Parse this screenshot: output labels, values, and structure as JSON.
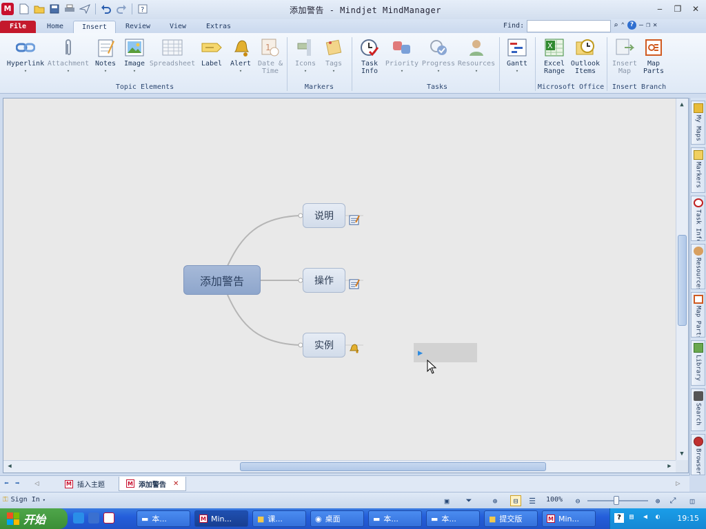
{
  "window": {
    "title": "添加警告 - Mindjet MindManager",
    "app_icon_letter": "M"
  },
  "tabs": [
    {
      "label": "File"
    },
    {
      "label": "Home"
    },
    {
      "label": "Insert"
    },
    {
      "label": "Review"
    },
    {
      "label": "View"
    },
    {
      "label": "Extras"
    }
  ],
  "find": {
    "label": "Find:",
    "value": ""
  },
  "ribbon": {
    "topic_elements": {
      "label": "Topic Elements",
      "buttons": [
        {
          "label": "Hyperlink"
        },
        {
          "label": "Attachment"
        },
        {
          "label": "Notes"
        },
        {
          "label": "Image"
        },
        {
          "label": "Spreadsheet"
        },
        {
          "label": "Label"
        },
        {
          "label": "Alert"
        },
        {
          "label1": "Date &",
          "label2": "Time"
        }
      ]
    },
    "markers": {
      "label": "Markers",
      "buttons": [
        {
          "label": "Icons"
        },
        {
          "label": "Tags"
        }
      ]
    },
    "tasks": {
      "label": "Tasks",
      "buttons": [
        {
          "label1": "Task",
          "label2": "Info"
        },
        {
          "label": "Priority"
        },
        {
          "label": "Progress"
        },
        {
          "label": "Resources"
        },
        {
          "label": "Gantt"
        }
      ]
    },
    "office": {
      "label": "Microsoft Office",
      "buttons": [
        {
          "label1": "Excel",
          "label2": "Range"
        },
        {
          "label1": "Outlook",
          "label2": "Items"
        }
      ]
    },
    "branch": {
      "label": "Insert Branch",
      "buttons": [
        {
          "label1": "Insert",
          "label2": "Map"
        },
        {
          "label1": "Map",
          "label2": "Parts"
        }
      ]
    }
  },
  "map": {
    "central": "添加警告",
    "subtopics": [
      {
        "text": "说明"
      },
      {
        "text": "操作"
      },
      {
        "text": "实例"
      }
    ]
  },
  "side_panels": [
    {
      "label": "My Maps"
    },
    {
      "label": "Markers"
    },
    {
      "label": "Task Info"
    },
    {
      "label": "Resources"
    },
    {
      "label": "Map Parts"
    },
    {
      "label": "Library"
    },
    {
      "label": "Search"
    },
    {
      "label": "Browser"
    }
  ],
  "doc_tabs": [
    {
      "label": "插入主题"
    },
    {
      "label": "添加警告"
    }
  ],
  "status": {
    "signin": "Sign In",
    "zoom": "100%"
  },
  "taskbar": {
    "start": "开始",
    "items": [
      {
        "label": "本..."
      },
      {
        "label": "Min..."
      },
      {
        "label": "课..."
      },
      {
        "label": "桌面"
      },
      {
        "label": "本..."
      },
      {
        "label": "本..."
      },
      {
        "label": "提交版"
      },
      {
        "label": "Min..."
      }
    ],
    "clock": "19:15"
  },
  "colors": {
    "file_tab": "#c4192c",
    "central_topic": "#8ea6cc",
    "taskbar": "#245edb",
    "start": "#3a8e36"
  }
}
